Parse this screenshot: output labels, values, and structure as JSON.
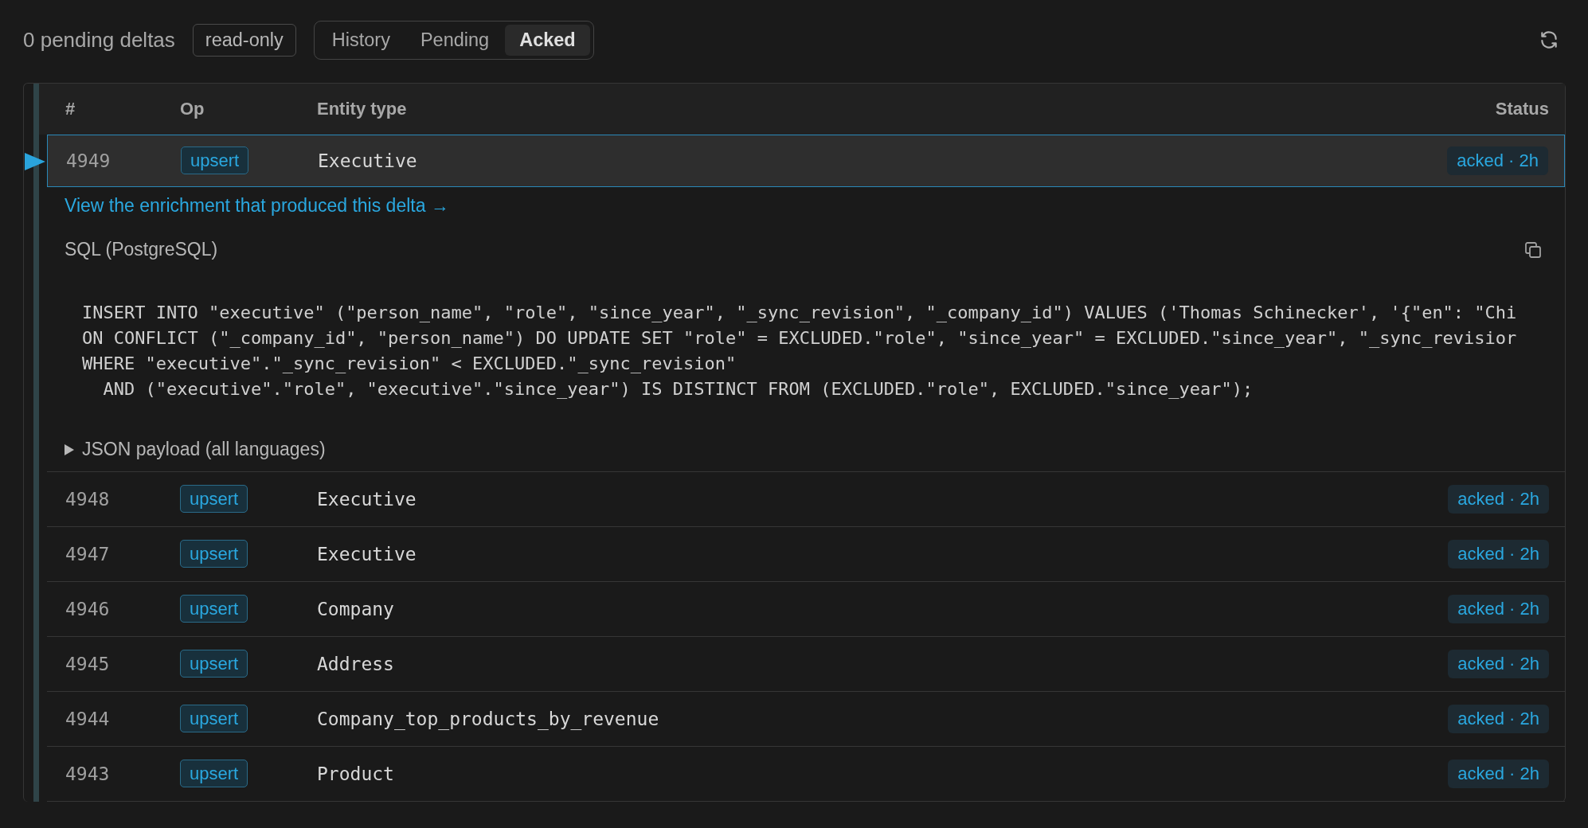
{
  "header": {
    "pending_count": "0 pending deltas",
    "mode_badge": "read-only",
    "tabs": [
      {
        "label": "History",
        "selected": false
      },
      {
        "label": "Pending",
        "selected": false
      },
      {
        "label": "Acked",
        "selected": true
      }
    ]
  },
  "table": {
    "columns": [
      "#",
      "Op",
      "Entity type",
      "Status"
    ],
    "rows": [
      {
        "id": "4949",
        "op": "upsert",
        "entity": "Executive",
        "status": "acked · 2h",
        "selected": true,
        "detail": {
          "link": "View the enrichment that produced this delta →",
          "sql_label": "SQL (PostgreSQL)",
          "sql_lines": [
            "INSERT INTO \"executive\" (\"person_name\", \"role\", \"since_year\", \"_sync_revision\", \"_company_id\") VALUES ('Thomas Schinecker', '{\"en\": \"Chi",
            "ON CONFLICT (\"_company_id\", \"person_name\") DO UPDATE SET \"role\" = EXCLUDED.\"role\", \"since_year\" = EXCLUDED.\"since_year\", \"_sync_revisior",
            "WHERE \"executive\".\"_sync_revision\" < EXCLUDED.\"_sync_revision\"",
            "  AND (\"executive\".\"role\", \"executive\".\"since_year\") IS DISTINCT FROM (EXCLUDED.\"role\", EXCLUDED.\"since_year\");"
          ],
          "payload_label": "JSON payload (all languages)",
          "payload_expanded": false
        }
      },
      {
        "id": "4948",
        "op": "upsert",
        "entity": "Executive",
        "status": "acked · 2h",
        "selected": false
      },
      {
        "id": "4947",
        "op": "upsert",
        "entity": "Executive",
        "status": "acked · 2h",
        "selected": false
      },
      {
        "id": "4946",
        "op": "upsert",
        "entity": "Company",
        "status": "acked · 2h",
        "selected": false
      },
      {
        "id": "4945",
        "op": "upsert",
        "entity": "Address",
        "status": "acked · 2h",
        "selected": false
      },
      {
        "id": "4944",
        "op": "upsert",
        "entity": "Company_top_products_by_revenue",
        "status": "acked · 2h",
        "selected": false
      },
      {
        "id": "4943",
        "op": "upsert",
        "entity": "Product",
        "status": "acked · 2h",
        "selected": false
      }
    ]
  }
}
